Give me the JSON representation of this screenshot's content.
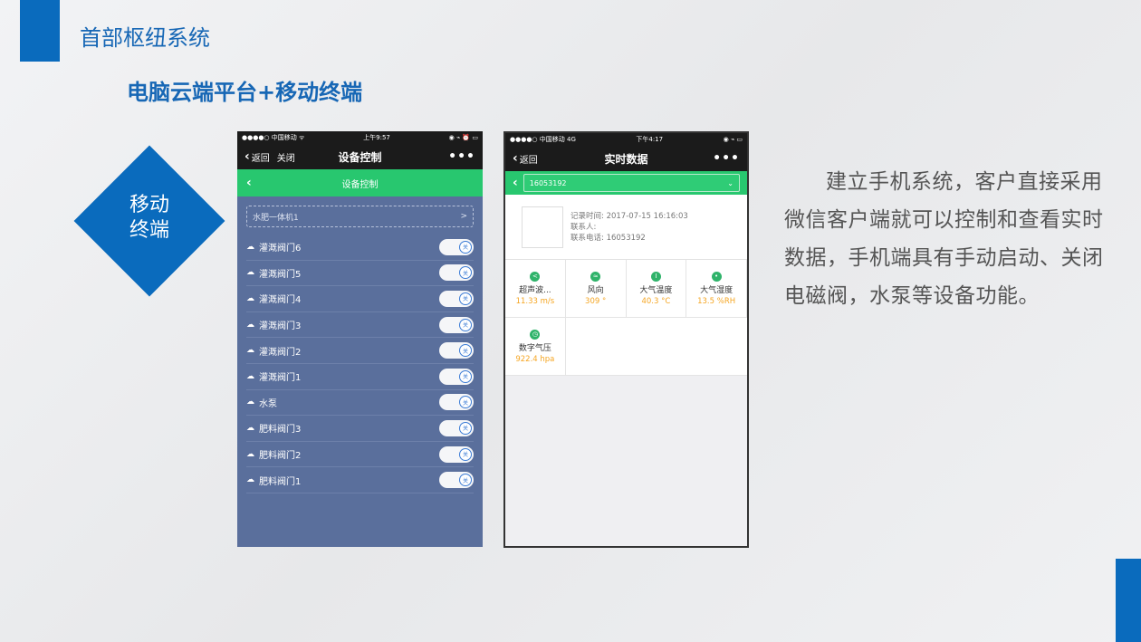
{
  "slide": {
    "title": "首部枢纽系统",
    "subtitle": "电脑云端平台+移动终端",
    "diamond_line1": "移动",
    "diamond_line2": "终端",
    "description": "建立手机系统，客户直接采用微信客户端就可以控制和查看实时数据，手机端具有手动启动、关闭电磁阀，水泵等设备功能。",
    "accent_color": "#0a6bbd"
  },
  "phone1": {
    "status": {
      "carrier": "●●●●○ 中国移动 ᯤ",
      "time": "上午9:57",
      "right": "◉ ⌁ ⏰ ▭"
    },
    "nav": {
      "back": "返回",
      "close": "关闭",
      "title": "设备控制",
      "more": "•••"
    },
    "green_title": "设备控制",
    "dropdown": {
      "value": "水肥一体机1",
      "arrow": ">"
    },
    "devices": [
      {
        "label": "灌溉阀门6",
        "state": "关"
      },
      {
        "label": "灌溉阀门5",
        "state": "关"
      },
      {
        "label": "灌溉阀门4",
        "state": "关"
      },
      {
        "label": "灌溉阀门3",
        "state": "关"
      },
      {
        "label": "灌溉阀门2",
        "state": "关"
      },
      {
        "label": "灌溉阀门1",
        "state": "关"
      },
      {
        "label": "水泵",
        "state": "关"
      },
      {
        "label": "肥料阀门3",
        "state": "关"
      },
      {
        "label": "肥料阀门2",
        "state": "关"
      },
      {
        "label": "肥料阀门1",
        "state": "关"
      }
    ]
  },
  "phone2": {
    "status": {
      "carrier": "●●●●○ 中国移动  4G",
      "time": "下午4:17",
      "right": "◉ ⌁ ▭"
    },
    "nav": {
      "back": "返回",
      "title": "实时数据",
      "more": "•••"
    },
    "sensor_id": "16053192",
    "info": {
      "record_time": "记录时间:  2017-07-15 16:16:03",
      "contact": "联系人:",
      "phone": "联系电话:  16053192"
    },
    "sensors": [
      {
        "name": "超声波...",
        "value": "11.33 m/s",
        "icon": "share-icon"
      },
      {
        "name": "风向",
        "value": "309 °",
        "icon": "wind-icon"
      },
      {
        "name": "大气温度",
        "value": "40.3 °C",
        "icon": "thermometer-icon"
      },
      {
        "name": "大气湿度",
        "value": "13.5 %RH",
        "icon": "droplet-icon"
      },
      {
        "name": "数字气压",
        "value": "922.4 hpa",
        "icon": "gauge-icon"
      }
    ],
    "value_color": "#f5a623"
  }
}
